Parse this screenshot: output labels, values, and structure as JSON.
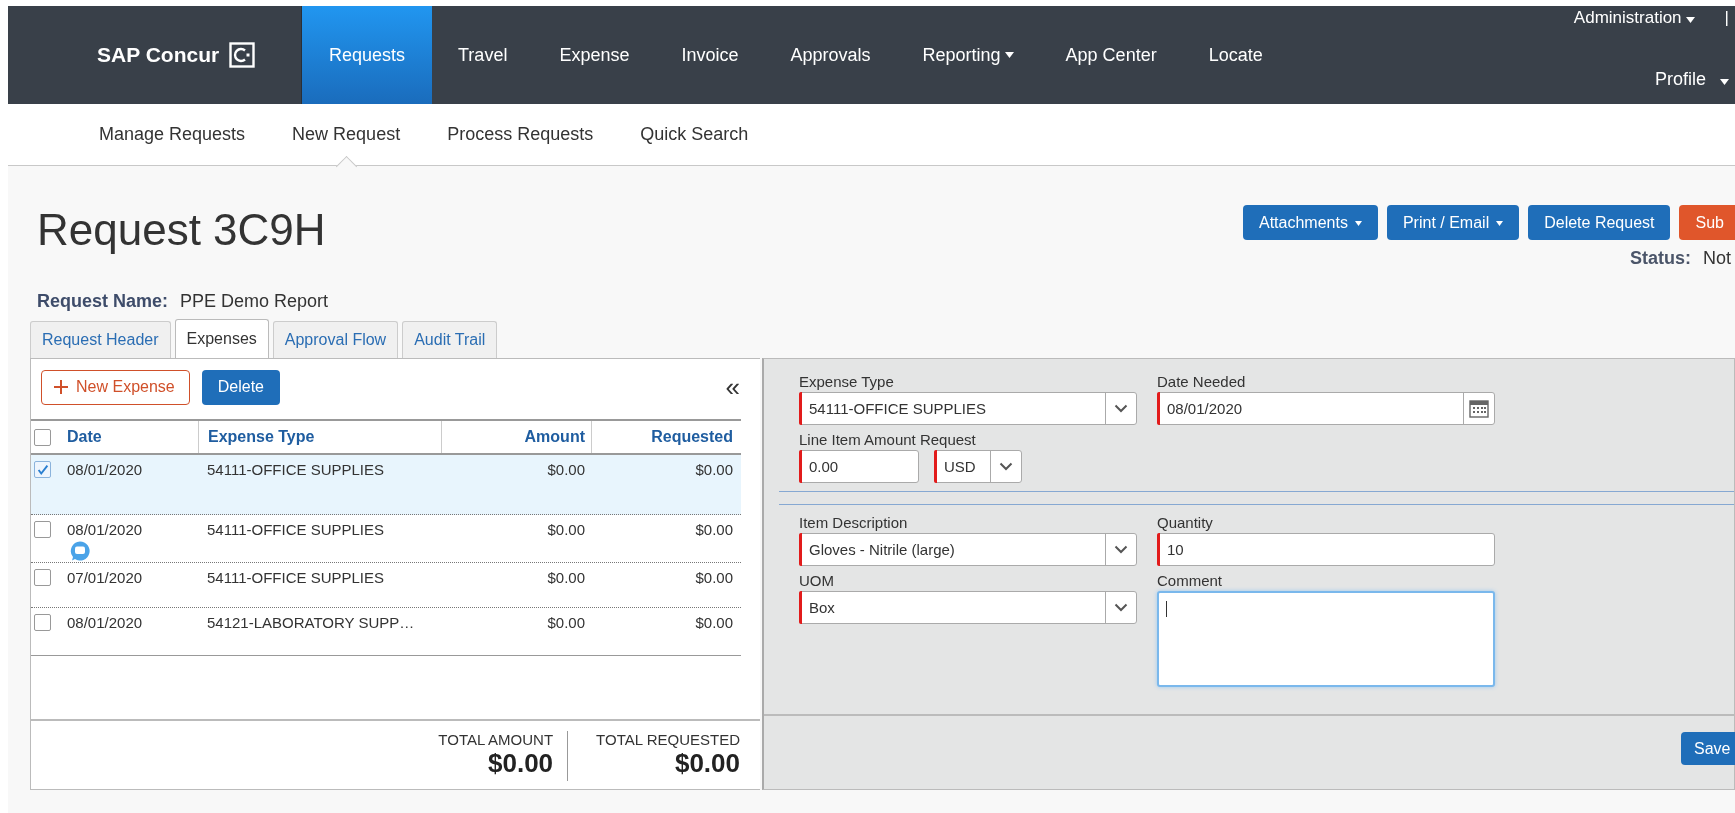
{
  "nav": {
    "logo": "SAP Concur",
    "items": [
      {
        "label": "Requests",
        "selected": true,
        "dropdown": false
      },
      {
        "label": "Travel",
        "selected": false,
        "dropdown": false
      },
      {
        "label": "Expense",
        "selected": false,
        "dropdown": false
      },
      {
        "label": "Invoice",
        "selected": false,
        "dropdown": false
      },
      {
        "label": "Approvals",
        "selected": false,
        "dropdown": false
      },
      {
        "label": "Reporting",
        "selected": false,
        "dropdown": true
      },
      {
        "label": "App Center",
        "selected": false,
        "dropdown": false
      },
      {
        "label": "Locate",
        "selected": false,
        "dropdown": false
      }
    ],
    "admin": "Administration",
    "separator": "|",
    "profile": "Profile"
  },
  "subnav": [
    {
      "label": "Manage Requests",
      "selected": false
    },
    {
      "label": "New Request",
      "selected": true
    },
    {
      "label": "Process Requests",
      "selected": false
    },
    {
      "label": "Quick Search",
      "selected": false
    }
  ],
  "title": "Request 3C9H",
  "actions": [
    {
      "label": "Attachments",
      "kind": "menu"
    },
    {
      "label": "Print / Email",
      "kind": "menu"
    },
    {
      "label": "Delete Request",
      "kind": "plain"
    },
    {
      "label": "Sub",
      "kind": "danger"
    }
  ],
  "status": {
    "label": "Status:",
    "value": "Not"
  },
  "request_name": {
    "label": "Request Name:",
    "value": "PPE Demo Report"
  },
  "tabs": [
    {
      "label": "Request Header",
      "selected": false
    },
    {
      "label": "Expenses",
      "selected": true
    },
    {
      "label": "Approval Flow",
      "selected": false
    },
    {
      "label": "Audit Trail",
      "selected": false
    }
  ],
  "expenses": {
    "new_button": "New Expense",
    "delete_button": "Delete",
    "collapse": "«",
    "all_checked": false,
    "columns": [
      "Date",
      "Expense Type",
      "Amount",
      "Requested"
    ],
    "rows": [
      {
        "date": "08/01/2020",
        "type": "54111-OFFICE SUPPLIES",
        "amount": "$0.00",
        "requested": "$0.00",
        "checked": true,
        "selected": true,
        "has_comment": false
      },
      {
        "date": "08/01/2020",
        "type": "54111-OFFICE SUPPLIES",
        "amount": "$0.00",
        "requested": "$0.00",
        "checked": false,
        "selected": false,
        "has_comment": true
      },
      {
        "date": "07/01/2020",
        "type": "54111-OFFICE SUPPLIES",
        "amount": "$0.00",
        "requested": "$0.00",
        "checked": false,
        "selected": false,
        "has_comment": false
      },
      {
        "date": "08/01/2020",
        "type": "54121-LABORATORY SUPP…",
        "amount": "$0.00",
        "requested": "$0.00",
        "checked": false,
        "selected": false,
        "has_comment": false
      }
    ],
    "totals": [
      {
        "label": "TOTAL AMOUNT",
        "value": "$0.00"
      },
      {
        "label": "TOTAL REQUESTED",
        "value": "$0.00"
      }
    ]
  },
  "form": {
    "sections": [
      {
        "fields": [
          {
            "label": "Expense Type",
            "kind": "select",
            "value": "54111-OFFICE SUPPLIES",
            "required": true
          },
          {
            "label": "Date Needed",
            "kind": "date",
            "value": "08/01/2020",
            "required": true
          },
          {
            "label": "Line Item Amount Request",
            "kind": "amount",
            "value": "0.00",
            "currency": "USD",
            "required": true
          }
        ]
      },
      {
        "fields": [
          {
            "label": "Item Description",
            "kind": "select",
            "value": "Gloves - Nitrile (large)",
            "required": true
          },
          {
            "label": "Quantity",
            "kind": "text",
            "value": "10",
            "required": true
          },
          {
            "label": "UOM",
            "kind": "select",
            "value": "Box",
            "required": true
          },
          {
            "label": "Comment",
            "kind": "textarea",
            "required": false,
            "focused": true
          }
        ]
      }
    ],
    "save": "Save"
  }
}
